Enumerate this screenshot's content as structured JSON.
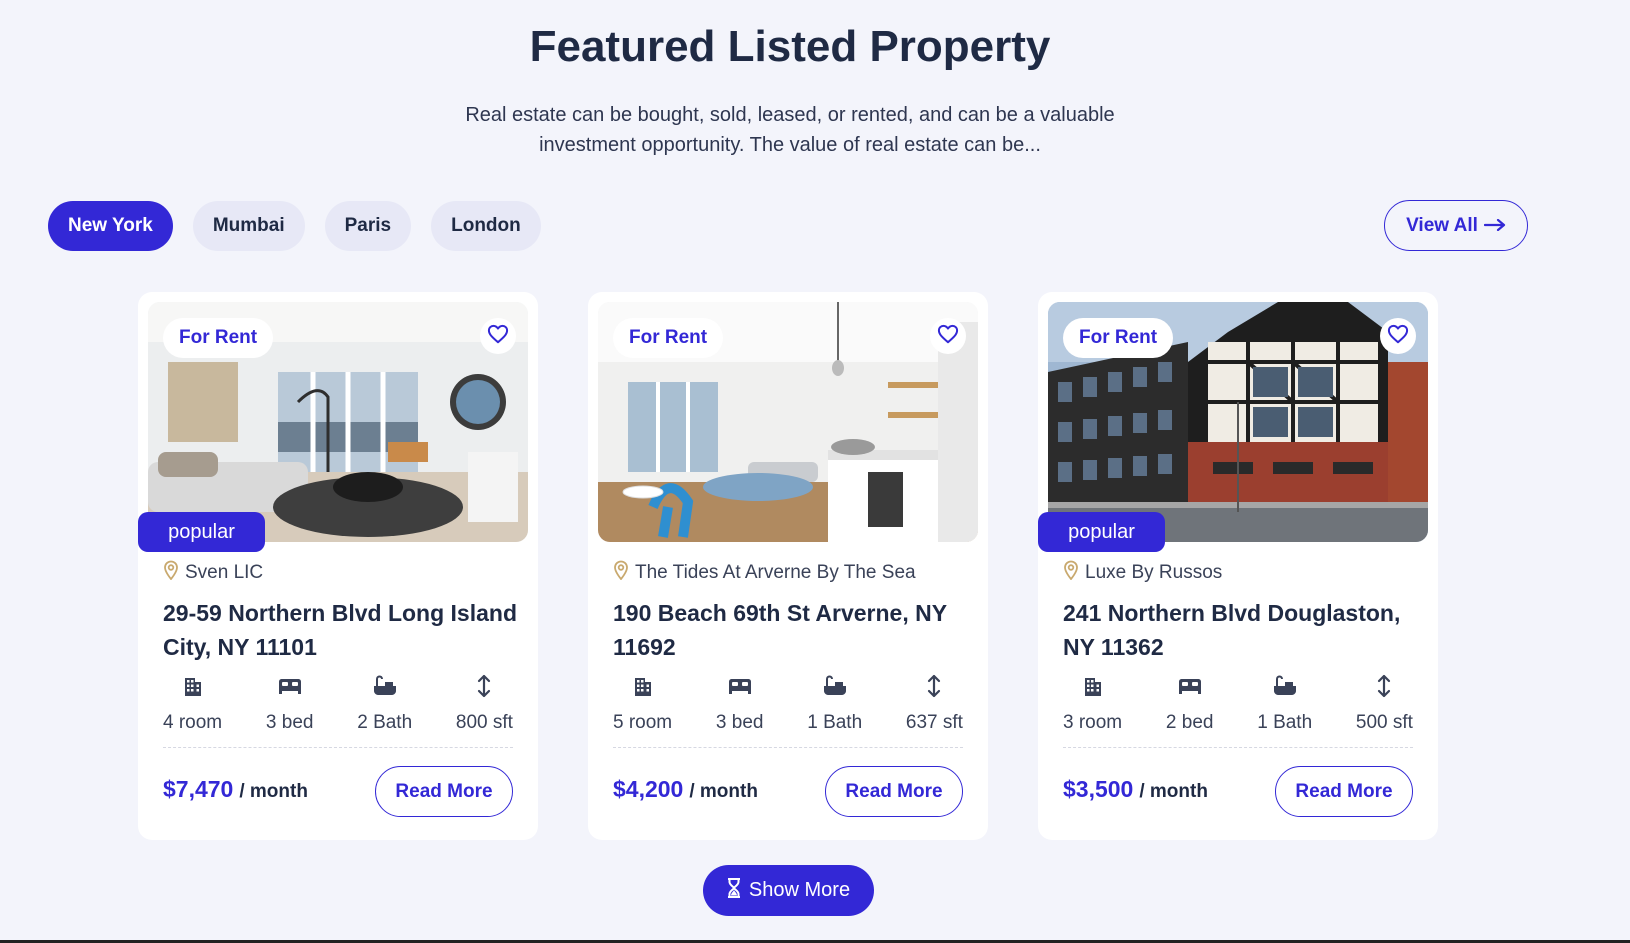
{
  "header": {
    "title": "Featured Listed Property",
    "description": "Real estate can be bought, sold, leased, or rented, and can be a valuable investment opportunity. The value of real estate can be..."
  },
  "tabs": [
    {
      "label": "New York",
      "active": true
    },
    {
      "label": "Mumbai",
      "active": false
    },
    {
      "label": "Paris",
      "active": false
    },
    {
      "label": "London",
      "active": false
    }
  ],
  "view_all_label": "View All",
  "view_all_icon": "arrow-right-icon",
  "show_more_label": "Show More",
  "show_more_icon": "hourglass-icon",
  "colors": {
    "accent": "#3328d6",
    "text_dark": "#1f2a44",
    "background": "#f3f4fb",
    "card": "#ffffff"
  },
  "listings": [
    {
      "badge": "For Rent",
      "popular_label": "popular",
      "is_popular": true,
      "location": "Sven LIC",
      "address": "29-59 Northern Blvd Long Island City, NY 11101",
      "features": {
        "rooms": "4 room",
        "beds": "3 bed",
        "baths": "2 Bath",
        "area": "800 sft"
      },
      "price": "$7,470",
      "price_unit": "/ month",
      "read_more_label": "Read More",
      "photo": "living-room-with-windows"
    },
    {
      "badge": "For Rent",
      "popular_label": "",
      "is_popular": false,
      "location": "The Tides At Arverne By The Sea",
      "address": "190 Beach 69th St Arverne, NY 11692",
      "features": {
        "rooms": "5 room",
        "beds": "3 bed",
        "baths": "1 Bath",
        "area": "637 sft"
      },
      "price": "$4,200",
      "price_unit": "/ month",
      "read_more_label": "Read More",
      "photo": "kitchen-and-living-room"
    },
    {
      "badge": "For Rent",
      "popular_label": "popular",
      "is_popular": true,
      "location": "Luxe By Russos",
      "address": "241 Northern Blvd Douglaston, NY 11362",
      "features": {
        "rooms": "3 room",
        "beds": "2 bed",
        "baths": "1 Bath",
        "area": "500 sft"
      },
      "price": "$3,500",
      "price_unit": "/ month",
      "read_more_label": "Read More",
      "photo": "tudor-style-building-exterior"
    }
  ]
}
